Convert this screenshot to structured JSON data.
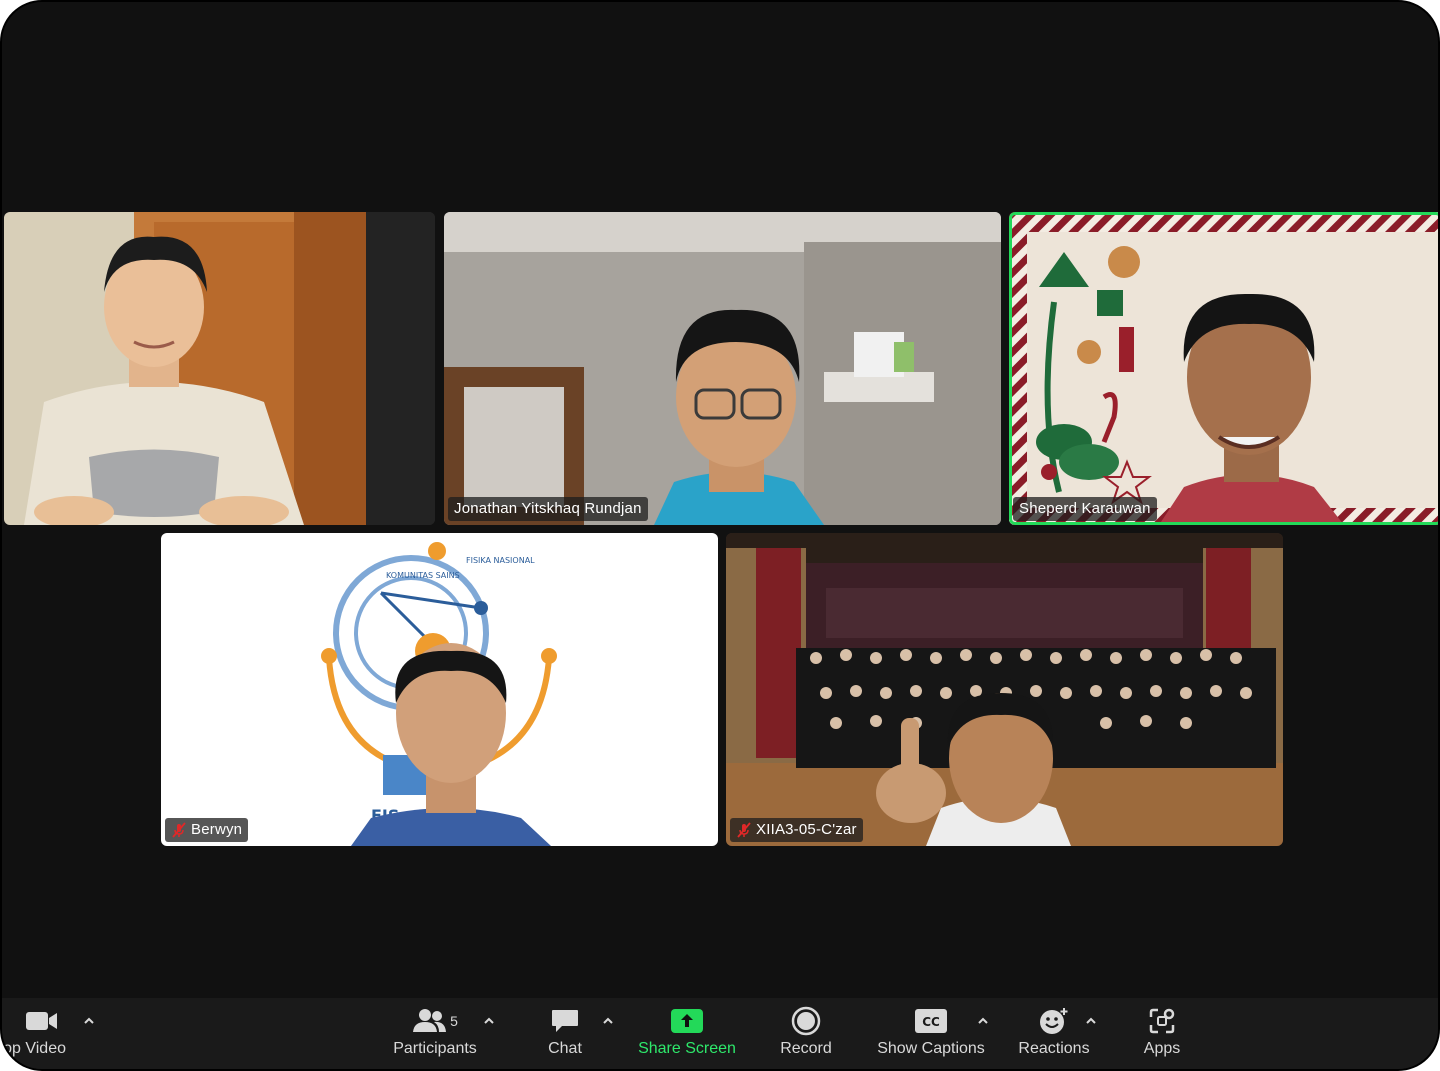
{
  "participants": [
    {
      "id": "p1",
      "name": "",
      "muted": false,
      "active": false
    },
    {
      "id": "p2",
      "name": "Jonathan Yitskhaq Rundjan",
      "muted": false,
      "active": false
    },
    {
      "id": "p3",
      "name": "Sheperd Karauwan",
      "muted": false,
      "active": true
    },
    {
      "id": "p4",
      "name": "Berwyn",
      "muted": true,
      "active": false
    },
    {
      "id": "p5",
      "name": "XIIA3-05-C'zar",
      "muted": true,
      "active": false
    }
  ],
  "background_text": {
    "logo_left_arc": "KOMUNITAS SAINS",
    "logo_right_arc": "FISIKA NASIONAL",
    "logo_bottom": "FIS"
  },
  "toolbar": {
    "video_label": "Stop Video",
    "participants_label": "Participants",
    "participants_count": "5",
    "chat_label": "Chat",
    "share_label": "Share Screen",
    "record_label": "Record",
    "captions_label": "Show Captions",
    "captions_badge": "CC",
    "reactions_label": "Reactions",
    "apps_label": "Apps"
  },
  "colors": {
    "active_speaker": "#23d959",
    "share_green": "#2ee86b",
    "muted_red": "#e02828",
    "window_bg": "#111111"
  }
}
